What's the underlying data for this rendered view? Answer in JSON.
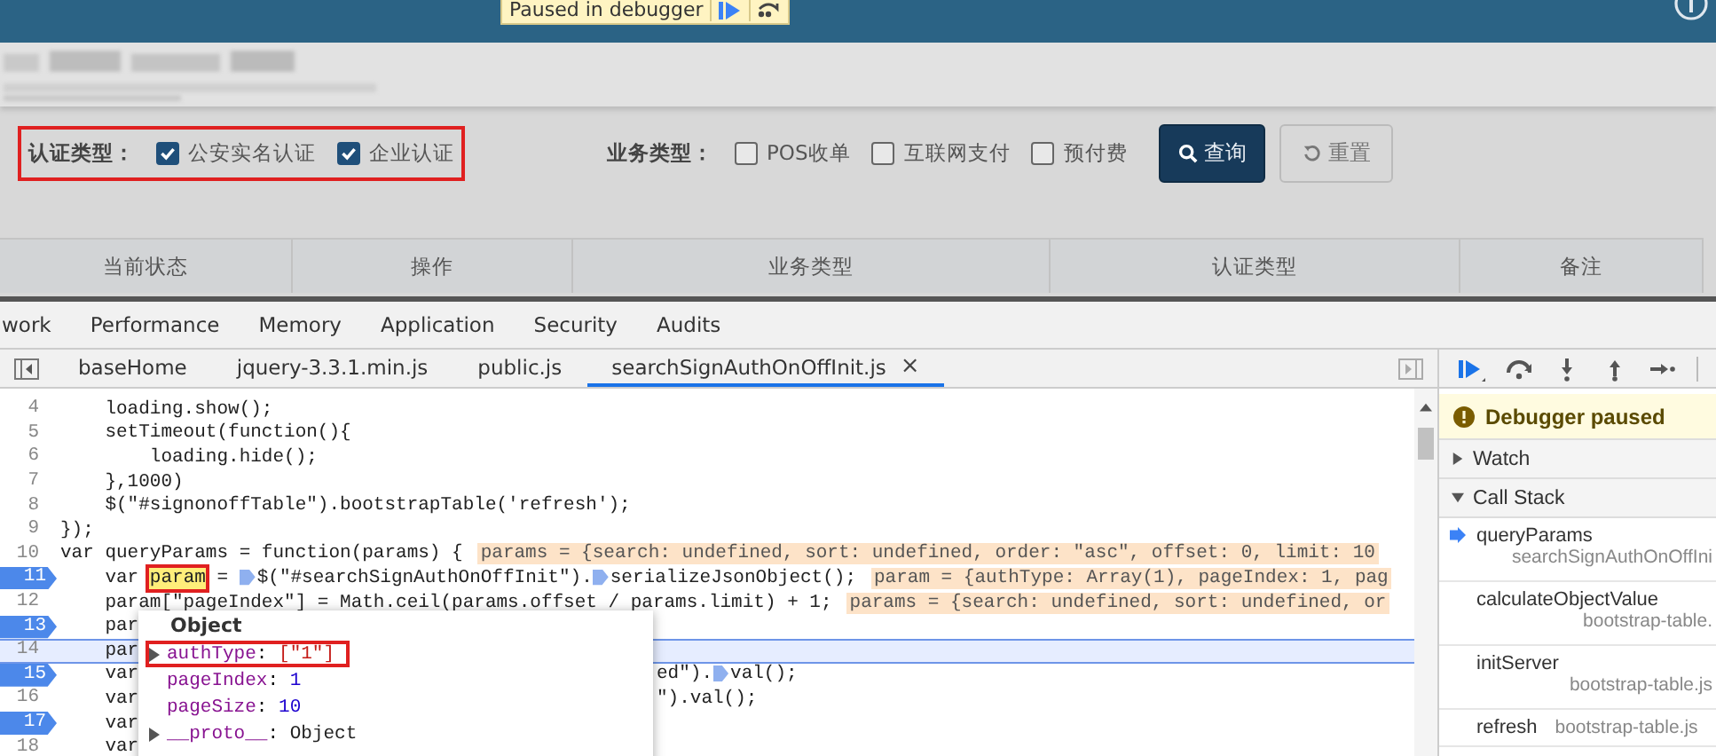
{
  "page": {
    "paused_badge": {
      "text": "Paused in debugger"
    },
    "filters": [
      {
        "label": "认证类型：",
        "annotated": true,
        "options": [
          {
            "label": "公安实名认证",
            "checked": true
          },
          {
            "label": "企业认证",
            "checked": true
          }
        ]
      },
      {
        "label": "业务类型：",
        "annotated": false,
        "options": [
          {
            "label": "POS收单",
            "checked": false
          },
          {
            "label": "互联网支付",
            "checked": false
          },
          {
            "label": "预付费",
            "checked": false
          }
        ]
      }
    ],
    "buttons": [
      {
        "label": "查询",
        "kind": "primary"
      },
      {
        "label": "重置",
        "kind": "default"
      }
    ],
    "table": {
      "columns": [
        "当前状态",
        "操作",
        "业务类型",
        "认证类型",
        "备注"
      ]
    }
  },
  "devtools": {
    "panel_tabs": [
      "work",
      "Performance",
      "Memory",
      "Application",
      "Security",
      "Audits"
    ],
    "file_tabs": [
      {
        "label": "baseHome",
        "selected": false,
        "closable": false
      },
      {
        "label": "jquery-3.3.1.min.js",
        "selected": false,
        "closable": false
      },
      {
        "label": "public.js",
        "selected": false,
        "closable": false
      },
      {
        "label": "searchSignAuthOnOffInit.js",
        "selected": true,
        "closable": true
      }
    ],
    "close_glyph": "×",
    "code_lines": [
      {
        "number": "4",
        "breakpoint": false,
        "current": false,
        "code": [
          {
            "kind": "plain",
            "text": "    loading.show();"
          }
        ]
      },
      {
        "number": "5",
        "breakpoint": false,
        "current": false,
        "code": [
          {
            "kind": "plain",
            "text": "    setTimeout(function(){"
          }
        ]
      },
      {
        "number": "6",
        "breakpoint": false,
        "current": false,
        "code": [
          {
            "kind": "plain",
            "text": "        loading.hide();"
          }
        ]
      },
      {
        "number": "7",
        "breakpoint": false,
        "current": false,
        "code": [
          {
            "kind": "plain",
            "text": "    },1000)"
          }
        ]
      },
      {
        "number": "8",
        "breakpoint": false,
        "current": false,
        "code": [
          {
            "kind": "plain",
            "text": "    $(\"#signonoffTable\").bootstrapTable('refresh');"
          }
        ]
      },
      {
        "number": "9",
        "breakpoint": false,
        "current": false,
        "code": [
          {
            "kind": "plain",
            "text": "});"
          }
        ]
      },
      {
        "number": "10",
        "breakpoint": false,
        "current": false,
        "code": [
          {
            "kind": "plain",
            "text": "var queryParams = function(params) {"
          }
        ],
        "inline_value": "params = {search: undefined, sort: undefined, order: \"asc\", offset: 0, limit: 10"
      },
      {
        "number": "11",
        "breakpoint": true,
        "current": false,
        "code": [
          {
            "kind": "plain",
            "text": "    var "
          },
          {
            "kind": "hover",
            "text": "param"
          },
          {
            "kind": "plain",
            "text": " = "
          },
          {
            "kind": "marker"
          },
          {
            "kind": "plain",
            "text": "$(\"#searchSignAuthOnOffInit\")."
          },
          {
            "kind": "marker"
          },
          {
            "kind": "plain",
            "text": "serializeJsonObject();"
          }
        ],
        "inline_value": "param = {authType: Array(1), pageIndex: 1, pag"
      },
      {
        "number": "12",
        "breakpoint": false,
        "current": false,
        "code": [
          {
            "kind": "plain",
            "text": "    param[\"pageIndex\"] = Math.ceil(params.offset / params.limit) + 1;"
          }
        ],
        "inline_value": "params = {search: undefined, sort: undefined, or"
      },
      {
        "number": "13",
        "breakpoint": true,
        "current": false,
        "code": [
          {
            "kind": "plain",
            "text": "    par"
          }
        ]
      },
      {
        "number": "14",
        "breakpoint": false,
        "current": true,
        "code": [
          {
            "kind": "plain",
            "text": "    par"
          }
        ]
      },
      {
        "number": "15",
        "breakpoint": true,
        "current": false,
        "code": [
          {
            "kind": "plain",
            "text": "    var"
          }
        ],
        "tail": [
          {
            "kind": "plain",
            "text": "ed\")."
          },
          {
            "kind": "marker"
          },
          {
            "kind": "plain",
            "text": "val();"
          }
        ]
      },
      {
        "number": "16",
        "breakpoint": false,
        "current": false,
        "code": [
          {
            "kind": "plain",
            "text": "    var"
          }
        ],
        "tail": [
          {
            "kind": "plain",
            "text": "\").val();"
          }
        ]
      },
      {
        "number": "17",
        "breakpoint": true,
        "current": false,
        "code": [
          {
            "kind": "plain",
            "text": "    var"
          }
        ]
      },
      {
        "number": "18",
        "breakpoint": false,
        "current": false,
        "code": [
          {
            "kind": "plain",
            "text": "    var"
          }
        ]
      }
    ],
    "popup": {
      "title": "Object",
      "separator": ":",
      "properties": [
        {
          "key": "authType",
          "value": "[\"1\"]",
          "kind": "array",
          "expandable": true,
          "annotated": true
        },
        {
          "key": "pageIndex",
          "value": "1",
          "kind": "number",
          "expandable": false,
          "annotated": false
        },
        {
          "key": "pageSize",
          "value": "10",
          "kind": "number",
          "expandable": false,
          "annotated": false
        },
        {
          "key": "__proto__",
          "value": "Object",
          "kind": "object",
          "expandable": true,
          "annotated": false
        }
      ]
    },
    "sidebar": {
      "status": "Debugger paused",
      "sections": [
        {
          "label": "Watch",
          "expanded": false
        },
        {
          "label": "Call Stack",
          "expanded": true
        }
      ],
      "call_stack": [
        {
          "function": "queryParams",
          "location": "searchSignAuthOnOffIni",
          "selected": true,
          "inline": false
        },
        {
          "function": "calculateObjectValue",
          "location": "bootstrap-table.",
          "selected": false,
          "inline": false
        },
        {
          "function": "initServer",
          "location": "bootstrap-table.js",
          "selected": false,
          "inline": false
        },
        {
          "function": "refresh",
          "location": "bootstrap-table.js",
          "selected": false,
          "inline": true
        }
      ]
    }
  }
}
